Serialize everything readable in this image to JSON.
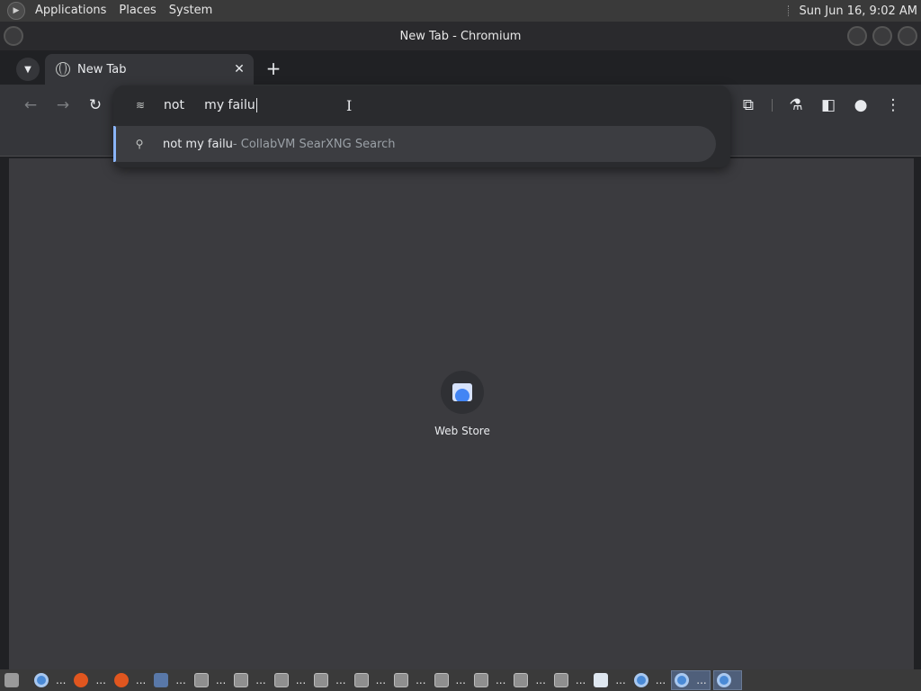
{
  "top_panel": {
    "menus": [
      "Applications",
      "Places",
      "System"
    ],
    "clock": "Sun Jun 16,  9:02 AM"
  },
  "window": {
    "title": "New Tab - Chromium"
  },
  "tabs": {
    "active_tab_title": "New Tab",
    "close_glyph": "✕",
    "new_tab_glyph": "+"
  },
  "omnibox": {
    "input_value": "not     my failu",
    "suggestion_query": "not my failu",
    "suggestion_provider": " - CollabVM SearXNG Search"
  },
  "ntp": {
    "shortcuts": [
      {
        "label": "Web Store",
        "icon": "web-store-icon"
      }
    ]
  },
  "taskbar": {
    "ellipsis": "...",
    "items": [
      {
        "icon": "file-manager-icon"
      },
      {
        "icon": "chromium-icon"
      },
      {
        "icon": "firefox-icon"
      },
      {
        "icon": "firefox-icon"
      },
      {
        "icon": "monitor-icon"
      },
      {
        "icon": "folder-icon"
      },
      {
        "icon": "folder-icon"
      },
      {
        "icon": "folder-icon"
      },
      {
        "icon": "folder-icon"
      },
      {
        "icon": "folder-icon"
      },
      {
        "icon": "folder-icon"
      },
      {
        "icon": "folder-icon"
      },
      {
        "icon": "folder-icon"
      },
      {
        "icon": "folder-icon"
      },
      {
        "icon": "folder-icon"
      },
      {
        "icon": "document-icon"
      },
      {
        "icon": "chromium-icon"
      },
      {
        "icon": "chromium-icon"
      },
      {
        "icon": "chromium-icon"
      }
    ]
  }
}
